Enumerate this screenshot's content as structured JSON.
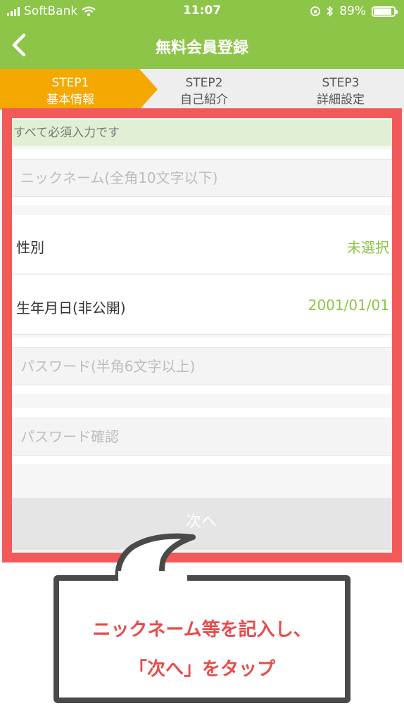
{
  "status_bar": {
    "carrier": "SoftBank",
    "time": "11:07",
    "battery": "89%",
    "battery_level": 0.89
  },
  "nav": {
    "title": "無料会員登録",
    "back_icon": "chevron-left-icon"
  },
  "steps": [
    {
      "num": "STEP1",
      "label": "基本情報",
      "active": true
    },
    {
      "num": "STEP2",
      "label": "自己紹介",
      "active": false
    },
    {
      "num": "STEP3",
      "label": "詳細設定",
      "active": false
    }
  ],
  "form": {
    "notice": "すべて必須入力です",
    "nickname_placeholder": "ニックネーム(全角10文字以下)",
    "nickname_value": "",
    "gender_label": "性別",
    "gender_value": "未選択",
    "birthday_label": "生年月日(非公開)",
    "birthday_value": "2001/01/01",
    "password_placeholder": "パスワード(半角6文字以上)",
    "password_value": "",
    "password_confirm_placeholder": "パスワード確認",
    "password_confirm_value": "",
    "next_label": "次へ"
  },
  "annotation": {
    "line1": "ニックネーム等を記入し、",
    "line2": "「次へ」をタップ"
  },
  "colors": {
    "accent_green": "#8cc548",
    "step_active": "#f5a800",
    "highlight_red": "#f25a5a",
    "annotation_text": "#e94b4b"
  }
}
